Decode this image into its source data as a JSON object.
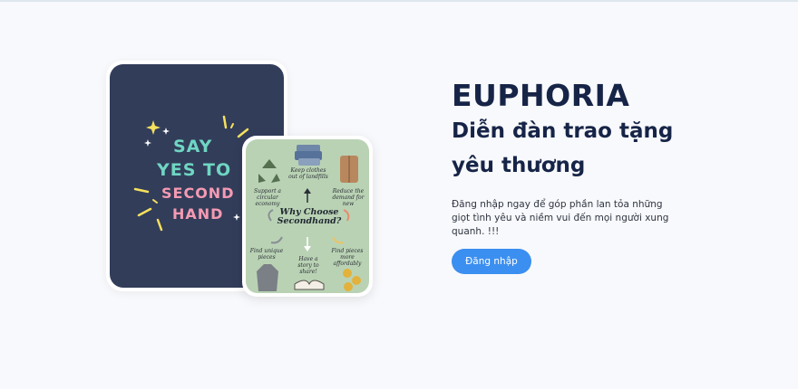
{
  "hero": {
    "brand": "EUPHORIA",
    "subtitle": "Diễn đàn trao tặng yêu thương",
    "description": "Đăng nhập ngay để góp phần lan tỏa những giọt tình yêu và niềm vui đến mọi người xung quanh. !!!",
    "login_label": "Đăng nhập"
  },
  "poster_say": {
    "line1": "SAY",
    "line2": "YES TO",
    "line3": "SECOND",
    "line4": "HAND"
  },
  "poster_why": {
    "title": "Why Choose Secondhand?",
    "items": [
      "Keep clothes out of landfills",
      "Reduce the demand for new",
      "Find pieces more affordably",
      "Have a story to share!",
      "Find unique pieces",
      "Support a circular economy"
    ]
  },
  "colors": {
    "accent": "#3b8ff0",
    "heading": "#162447",
    "poster_dark": "#323d5a",
    "poster_green": "#b9d2b4",
    "teal_text": "#6fd6c2",
    "pink_text": "#f49ab2"
  }
}
